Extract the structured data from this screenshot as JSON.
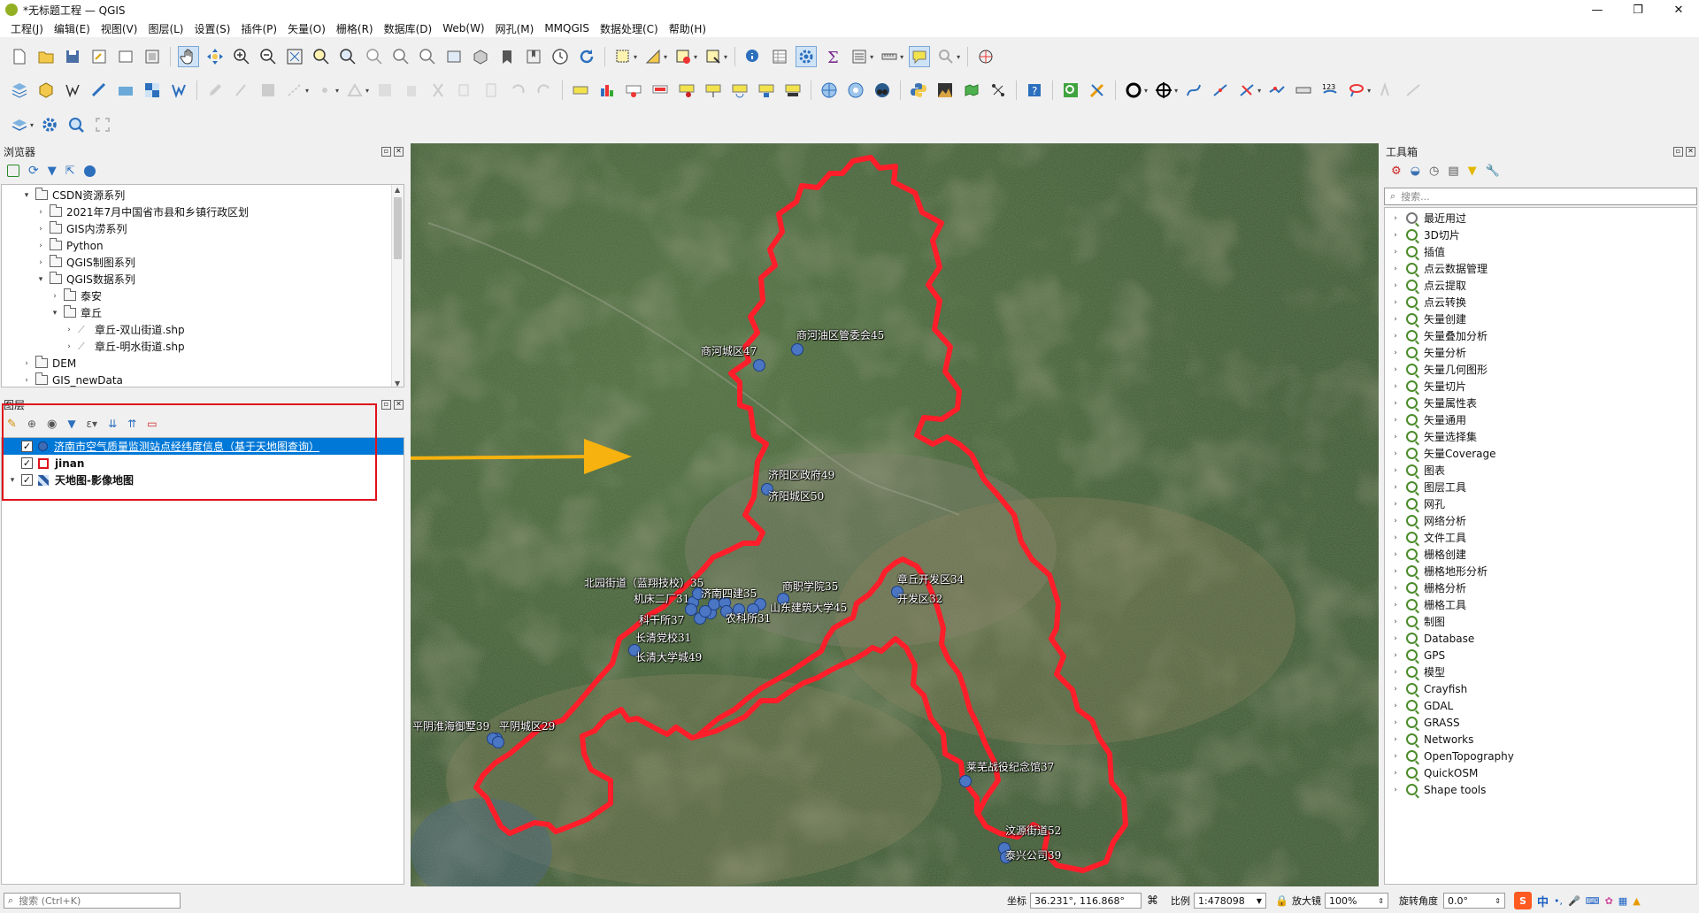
{
  "window": {
    "title": "*无标题工程 — QGIS"
  },
  "menu": [
    "工程(J)",
    "编辑(E)",
    "视图(V)",
    "图层(L)",
    "设置(S)",
    "插件(P)",
    "矢量(O)",
    "栅格(R)",
    "数据库(D)",
    "Web(W)",
    "网孔(M)",
    "MMQGIS",
    "数据处理(C)",
    "帮助(H)"
  ],
  "browser": {
    "title": "浏览器",
    "items": [
      {
        "label": "CSDN资源系列",
        "level": 1,
        "expanded": true,
        "type": "folder"
      },
      {
        "label": "2021年7月中国省市县和乡镇行政区划",
        "level": 2,
        "expanded": false,
        "type": "folder"
      },
      {
        "label": "GIS内涝系列",
        "level": 2,
        "expanded": false,
        "type": "folder"
      },
      {
        "label": "Python",
        "level": 2,
        "expanded": false,
        "type": "folder"
      },
      {
        "label": "QGIS制图系列",
        "level": 2,
        "expanded": false,
        "type": "folder"
      },
      {
        "label": "QGIS数据系列",
        "level": 2,
        "expanded": true,
        "type": "folder"
      },
      {
        "label": "泰安",
        "level": 3,
        "expanded": false,
        "type": "folder"
      },
      {
        "label": "章丘",
        "level": 3,
        "expanded": true,
        "type": "folder"
      },
      {
        "label": "章丘-双山街道.shp",
        "level": 4,
        "expanded": false,
        "type": "shp"
      },
      {
        "label": "章丘-明水街道.shp",
        "level": 4,
        "expanded": false,
        "type": "shp"
      },
      {
        "label": "DEM",
        "level": 1,
        "expanded": false,
        "type": "folder"
      },
      {
        "label": "GIS_newData",
        "level": 1,
        "expanded": false,
        "type": "folder"
      }
    ]
  },
  "layers": {
    "title": "图层",
    "items": [
      {
        "label": "济南市空气质量监测站点经纬度信息（基于天地图查询）",
        "checked": true,
        "selected": true
      },
      {
        "label": "jinan",
        "checked": true,
        "selected": false
      },
      {
        "label": "天地图-影像地图",
        "checked": true,
        "selected": false
      }
    ]
  },
  "toolbox": {
    "title": "工具箱",
    "search_placeholder": "搜索...",
    "items": [
      "最近用过",
      "3D切片",
      "插值",
      "点云数据管理",
      "点云提取",
      "点云转换",
      "矢量创建",
      "矢量叠加分析",
      "矢量分析",
      "矢量几何图形",
      "矢量切片",
      "矢量属性表",
      "矢量通用",
      "矢量选择集",
      "矢量Coverage",
      "图表",
      "图层工具",
      "网孔",
      "网络分析",
      "文件工具",
      "栅格创建",
      "栅格地形分析",
      "栅格分析",
      "栅格工具",
      "制图",
      "Database",
      "GPS",
      "模型",
      "Crayfish",
      "GDAL",
      "GRASS",
      "Networks",
      "OpenTopography",
      "QuickOSM",
      "Shape tools"
    ]
  },
  "map_labels": [
    {
      "text": "商河城区47"
    },
    {
      "text": "商河油区管委会45"
    },
    {
      "text": "济阳区政府49"
    },
    {
      "text": "济阳城区50"
    },
    {
      "text": "北园街道（蓝翔技校）35"
    },
    {
      "text": "机床二厂31"
    },
    {
      "text": "济南四建35"
    },
    {
      "text": "商职学院35"
    },
    {
      "text": "山东建筑大学45"
    },
    {
      "text": "农科所31"
    },
    {
      "text": "科干所37"
    },
    {
      "text": "长清党校31"
    },
    {
      "text": "长清大学城49"
    },
    {
      "text": "章丘开发区34"
    },
    {
      "text": "开发区32"
    },
    {
      "text": "平阴淮海御墅39"
    },
    {
      "text": "平阴城区29"
    },
    {
      "text": "莱芜战役纪念馆37"
    },
    {
      "text": "汶源街道52"
    },
    {
      "text": "泰兴公司39"
    }
  ],
  "status": {
    "search_placeholder": "搜索 (Ctrl+K)",
    "coord_label": "坐标",
    "coord_value": "36.231°, 116.868°",
    "scale_label": "比例",
    "scale_value": "1:478098",
    "mag_label": "放大镜",
    "mag_value": "100%",
    "rot_label": "旋转角度",
    "rot_value": "0.0°",
    "ime": "中"
  },
  "colors": {
    "boundary": "#ff1e2a",
    "highlight_box": "#e0121b",
    "arrow": "#f7b20f",
    "selected_row": "#0078d7",
    "point": "#4a76c4"
  }
}
